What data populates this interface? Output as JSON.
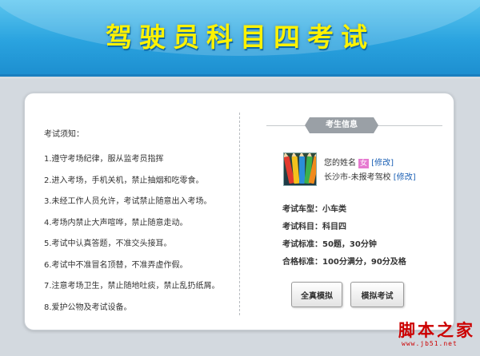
{
  "header": {
    "title": "驾驶员科目四考试"
  },
  "rules": {
    "title": "考试须知：",
    "items": [
      "1.遵守考场纪律，服从监考员指挥",
      "2.进入考场，手机关机，禁止抽烟和吃零食。",
      "3.未经工作人员允许，考试禁止随意出入考场。",
      "4.考场内禁止大声喧哗，禁止随意走动。",
      "5.考试中认真答题，不准交头接耳。",
      "6.考试中不准冒名顶替，不准弄虚作假。",
      "7.注意考场卫生，禁止随地吐痰，禁止乱扔纸屑。",
      "8.爱护公物及考试设备。"
    ]
  },
  "candidate": {
    "panel_title": "考生信息",
    "name": "您的姓名",
    "gender": "女",
    "edit_label": "[修改]",
    "school": "长沙市-未报考驾校",
    "school_edit_label": "[修改]",
    "details": [
      "考试车型：小车类",
      "考试科目：科目四",
      "考试标准：50题，30分钟",
      "合格标准：100分满分，90分及格"
    ]
  },
  "buttons": {
    "full_sim": "全真模拟",
    "mock_exam": "模拟考试"
  },
  "watermark": {
    "text": "脚本之家",
    "url": "www.jb51.net"
  },
  "colors": {
    "header_blue": "#2aa3df",
    "title_yellow": "#fff200",
    "link_blue": "#1a5fb4",
    "gender_pink": "#e67ad0",
    "watermark_red": "#cc0000"
  }
}
